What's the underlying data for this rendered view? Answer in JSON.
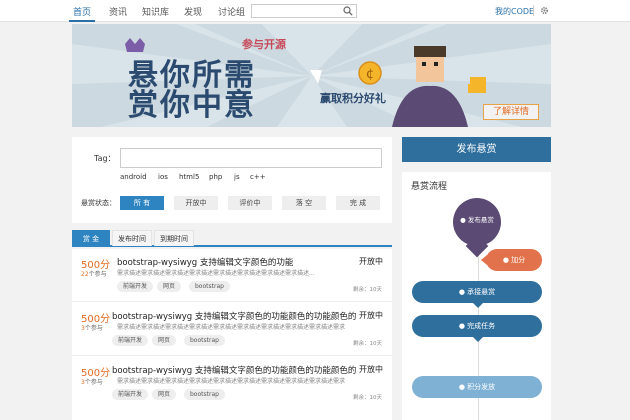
{
  "nav": {
    "items": [
      "首页",
      "资讯",
      "知识库",
      "发现",
      "讨论组"
    ],
    "active": 0,
    "search_placeholder": "",
    "my_code": "我的CODE"
  },
  "banner": {
    "line1": "参与开源",
    "line2": "悬你所需",
    "line3": "赏你中意",
    "slogan": "赢取积分好礼",
    "more": "了解详情"
  },
  "filter": {
    "tag_label": "Tag：",
    "tag_value": "",
    "tags": [
      "android",
      "ios",
      "html5",
      "php",
      "js",
      "c++"
    ],
    "status_label": "悬赏状态：",
    "statuses": [
      "所 有",
      "开放中",
      "评价中",
      "落 空",
      "完 成"
    ]
  },
  "list": {
    "tabs": [
      "赏 金",
      "发布时间",
      "到期时间"
    ],
    "rows": [
      {
        "amount": "500分",
        "joined_count": "22",
        "joined_suffix": "个参与",
        "title": "bootstrap-wysiwyg 支持编辑文字颜色的功能",
        "desc": "需求描述需求描述需求描述需求描述需求描述需求描述需求描述需求描述...",
        "status": "开放中",
        "tags": [
          "前端开发",
          "网页",
          "bootstrap"
        ],
        "remain": "剩余：10天"
      },
      {
        "amount": "500分",
        "joined_count": "3",
        "joined_suffix": "个参与",
        "title": "bootstrap-wysiwyg 支持编辑文字颜色的功能颜色的功能颜色的功",
        "desc": "需求描述需求描述需求描述需求描述需求描述需求描述需求描述需求描述需求描述需求",
        "status": "开放中",
        "tags": [
          "前端开发",
          "网页",
          "bootstrap"
        ],
        "remain": "剩余：10天"
      },
      {
        "amount": "500分",
        "joined_count": "3",
        "joined_suffix": "个参与",
        "title": "bootstrap-wysiwyg 支持编辑文字颜色的功能颜色的功能颜色的功",
        "desc": "需求描述需求描述需求描述需求描述需求描述需求描述需求描述需求描述需求描述需求",
        "status": "开放中",
        "tags": [
          "前端开发",
          "网页",
          "bootstrap"
        ],
        "remain": "剩余：10天"
      }
    ]
  },
  "sidebar": {
    "publish": "发布悬赏",
    "flow_title": "悬赏流程",
    "steps": [
      "发布悬赏",
      "加分",
      "承接悬赏",
      "完成任务",
      "积分发放"
    ]
  },
  "colors": {
    "primary": "#2d84c0",
    "dark_blue": "#2f6f9e",
    "accent": "#e26b22",
    "purple": "#5a4a74"
  }
}
